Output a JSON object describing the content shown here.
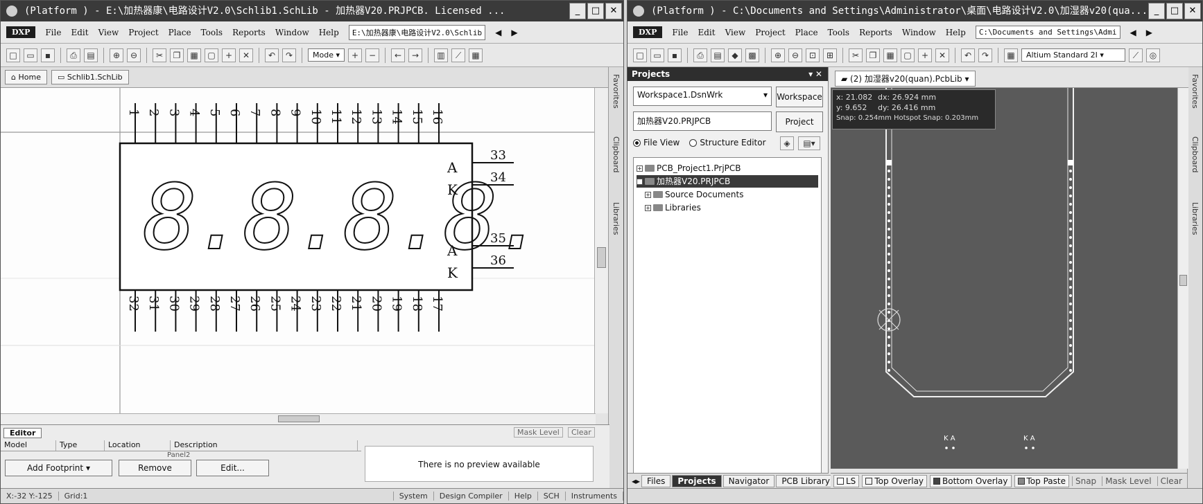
{
  "left_window": {
    "title": "(Platform ) - E:\\加热器康\\电路设计V2.0\\Schlib1.SchLib - 加热器V20.PRJPCB. Licensed ...",
    "menu": [
      "File",
      "Edit",
      "View",
      "Project",
      "Place",
      "Tools",
      "Reports",
      "Window",
      "Help"
    ],
    "dxp_label": "DXP",
    "path_box": "E:\\加热器康\\电路设计V2.0\\Schlib",
    "mode_label": "Mode",
    "nav": {
      "home": "Home",
      "doc": "Schlib1.SchLib"
    },
    "side_tabs": [
      "Favorites",
      "Clipboard",
      "Libraries"
    ],
    "component": {
      "top_pins": [
        "1",
        "2",
        "3",
        "4",
        "5",
        "6",
        "7",
        "8",
        "9",
        "10",
        "11",
        "12",
        "13",
        "14",
        "15",
        "16"
      ],
      "bottom_pins": [
        "32",
        "31",
        "30",
        "29",
        "28",
        "27",
        "26",
        "25",
        "24",
        "23",
        "22",
        "21",
        "20",
        "19",
        "18",
        "17"
      ],
      "right_pins": [
        {
          "num": "33",
          "label": "A"
        },
        {
          "num": "34",
          "label": "K"
        },
        {
          "num": "35",
          "label": "A"
        },
        {
          "num": "36",
          "label": "K"
        }
      ],
      "digits": "8.8.8.8."
    },
    "editor_tab": "Editor",
    "mask_level": "Mask Level",
    "clear": "Clear",
    "model_headers": [
      "Model",
      "Type",
      "Location",
      "Description"
    ],
    "model_caption": "Panel2",
    "buttons": {
      "add_footprint": "Add Footprint",
      "remove": "Remove",
      "edit": "Edit..."
    },
    "preview_text": "There is no preview available",
    "status": {
      "coords": "X:-32 Y:-125",
      "grid": "Grid:1",
      "items": [
        "System",
        "Design Compiler",
        "Help",
        "SCH",
        "Instruments"
      ]
    }
  },
  "right_window": {
    "title": "(Platform ) - C:\\Documents and Settings\\Administrator\\桌面\\电路设计V2.0\\加湿器v20(qua...",
    "menu": [
      "File",
      "Edit",
      "View",
      "Project",
      "Place",
      "Tools",
      "Reports",
      "Window",
      "Help"
    ],
    "dxp_label": "DXP",
    "path_box": "C:\\Documents and Settings\\Admi",
    "layer_combo": "Altium Standard 2I",
    "panel": {
      "title": "Projects",
      "workspace_value": "Workspace1.DsnWrk",
      "workspace_btn": "Workspace",
      "project_value": "加热器V20.PRJPCB",
      "project_btn": "Project",
      "file_view": "File View",
      "structure_editor": "Structure Editor",
      "tree": [
        {
          "label": "PCB_Project1.PrjPCB",
          "level": 0,
          "selected": false
        },
        {
          "label": "加热器V20.PRJPCB",
          "level": 0,
          "selected": true
        },
        {
          "label": "Source Documents",
          "level": 1,
          "selected": false
        },
        {
          "label": "Libraries",
          "level": 1,
          "selected": false
        }
      ]
    },
    "doc_tab": "(2) 加湿器v20(quan).PcbLib",
    "coords": {
      "x": "x: 21.082",
      "dx": "dx: 26.924 mm",
      "y": "y: 9.652",
      "dy": "dy: 26.416 mm",
      "snap": "Snap: 0.254mm Hotspot Snap: 0.203mm"
    },
    "pad_labels": [
      "K A",
      "K A"
    ],
    "side_tabs": [
      "Favorites",
      "Clipboard",
      "Libraries"
    ],
    "bottom_tabs": [
      "Files",
      "Projects",
      "Navigator",
      "PCB Library"
    ],
    "active_bottom_tab": "Projects",
    "layers": [
      {
        "label": "LS",
        "color": "#ffffff"
      },
      {
        "label": "Top Overlay",
        "color": "#f2f2f2"
      },
      {
        "label": "Bottom Overlay",
        "color": "#444444"
      },
      {
        "label": "Top Paste",
        "color": "#888888"
      }
    ],
    "layer_tools": [
      "Snap",
      "Mask Level",
      "Clear"
    ]
  }
}
